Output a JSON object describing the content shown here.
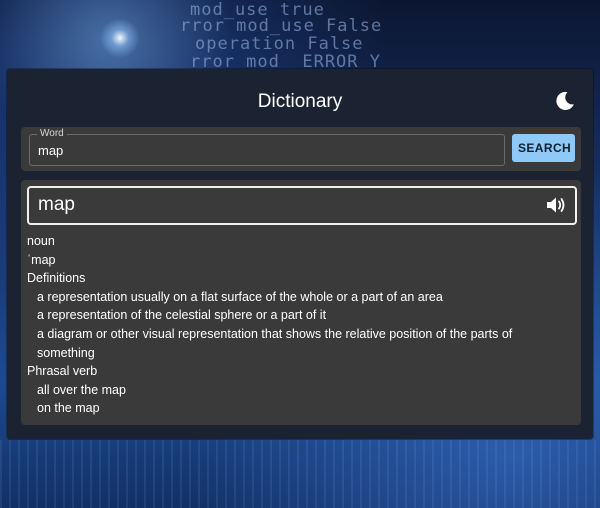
{
  "app": {
    "title": "Dictionary",
    "theme_icon": "moon-icon"
  },
  "search": {
    "label": "Word",
    "value": "map",
    "button_label": "SEARCH"
  },
  "result": {
    "word": "map",
    "audio_icon": "speaker-icon",
    "part_of_speech": "noun",
    "phonetic": "ˈmap",
    "definitions_heading": "Definitions",
    "definitions": [
      "a representation usually on a flat surface of the whole or a part of an area",
      "a representation of the celestial sphere or a part of it",
      "a diagram or other visual representation that shows the relative position of the parts of",
      "something"
    ],
    "phrasal_heading": "Phrasal verb",
    "phrasal_verbs": [
      "all over the map",
      "on the map"
    ]
  },
  "colors": {
    "panel": "#1b2333",
    "card": "#3a3a3a",
    "accent_button": "#8fc9f7"
  }
}
